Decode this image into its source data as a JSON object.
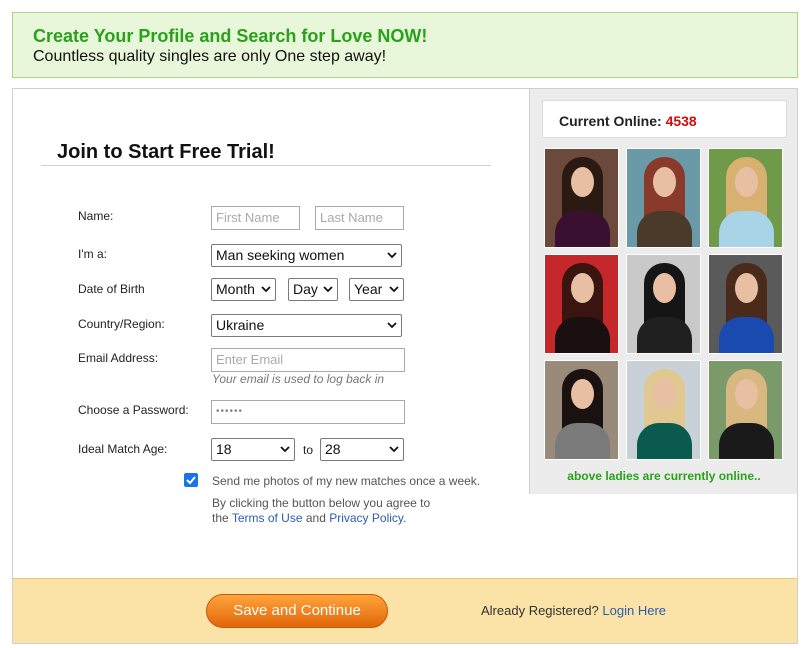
{
  "banner": {
    "title": "Create Your Profile and Search for Love NOW!",
    "subtitle": "Countless quality singles are only One step away!"
  },
  "form": {
    "title": "Join to Start Free Trial!",
    "name_label": "Name:",
    "first_name_placeholder": "First Name",
    "last_name_placeholder": "Last Name",
    "seeking_label": "I'm a:",
    "seeking_value": "Man seeking women",
    "dob_label": "Date of Birth",
    "dob_month": "Month",
    "dob_day": "Day",
    "dob_year": "Year",
    "country_label": "Country/Region:",
    "country_value": "Ukraine",
    "email_label": "Email Address:",
    "email_placeholder": "Enter Email",
    "email_hint": "Your email is used to log back in",
    "password_label": "Choose a Password:",
    "password_mask": "••••••",
    "age_label": "Ideal Match Age:",
    "age_from": "18",
    "age_to_word": "to",
    "age_to": "28",
    "newsletter_checked": true,
    "newsletter_text": "Send me photos of my new matches once a week.",
    "terms_prefix": "By clicking the button below you agree to",
    "terms_the": "the",
    "terms_link": "Terms of Use",
    "terms_and": "and",
    "privacy_link": "Privacy Policy",
    "terms_period": "."
  },
  "footer": {
    "save_button": "Save and Continue",
    "already_registered": "Already Registered?",
    "login_link": "Login Here"
  },
  "sidebar": {
    "online_label": "Current Online:",
    "online_count": "4538",
    "online_note": "above ladies are currently online..",
    "photos": [
      {
        "bg": "#6b4a3c",
        "hair": "#2a1a12",
        "dress": "#3a1030"
      },
      {
        "bg": "#6a9aa8",
        "hair": "#8a3a2a",
        "dress": "#4a3a2a"
      },
      {
        "bg": "#6f9a4a",
        "hair": "#d8b070",
        "dress": "#a9d4e8"
      },
      {
        "bg": "#c4282a",
        "hair": "#3a1510",
        "dress": "#1a1010"
      },
      {
        "bg": "#c9c9c9",
        "hair": "#151515",
        "dress": "#202020"
      },
      {
        "bg": "#5a5a5a",
        "hair": "#4a2a1a",
        "dress": "#1a4ab0"
      },
      {
        "bg": "#9a8a7a",
        "hair": "#1a1210",
        "dress": "#7a7a7a"
      },
      {
        "bg": "#c8d0d8",
        "hair": "#e0c890",
        "dress": "#0a5a50"
      },
      {
        "bg": "#7a9a6a",
        "hair": "#d8b880",
        "dress": "#1a1a1a"
      }
    ]
  }
}
